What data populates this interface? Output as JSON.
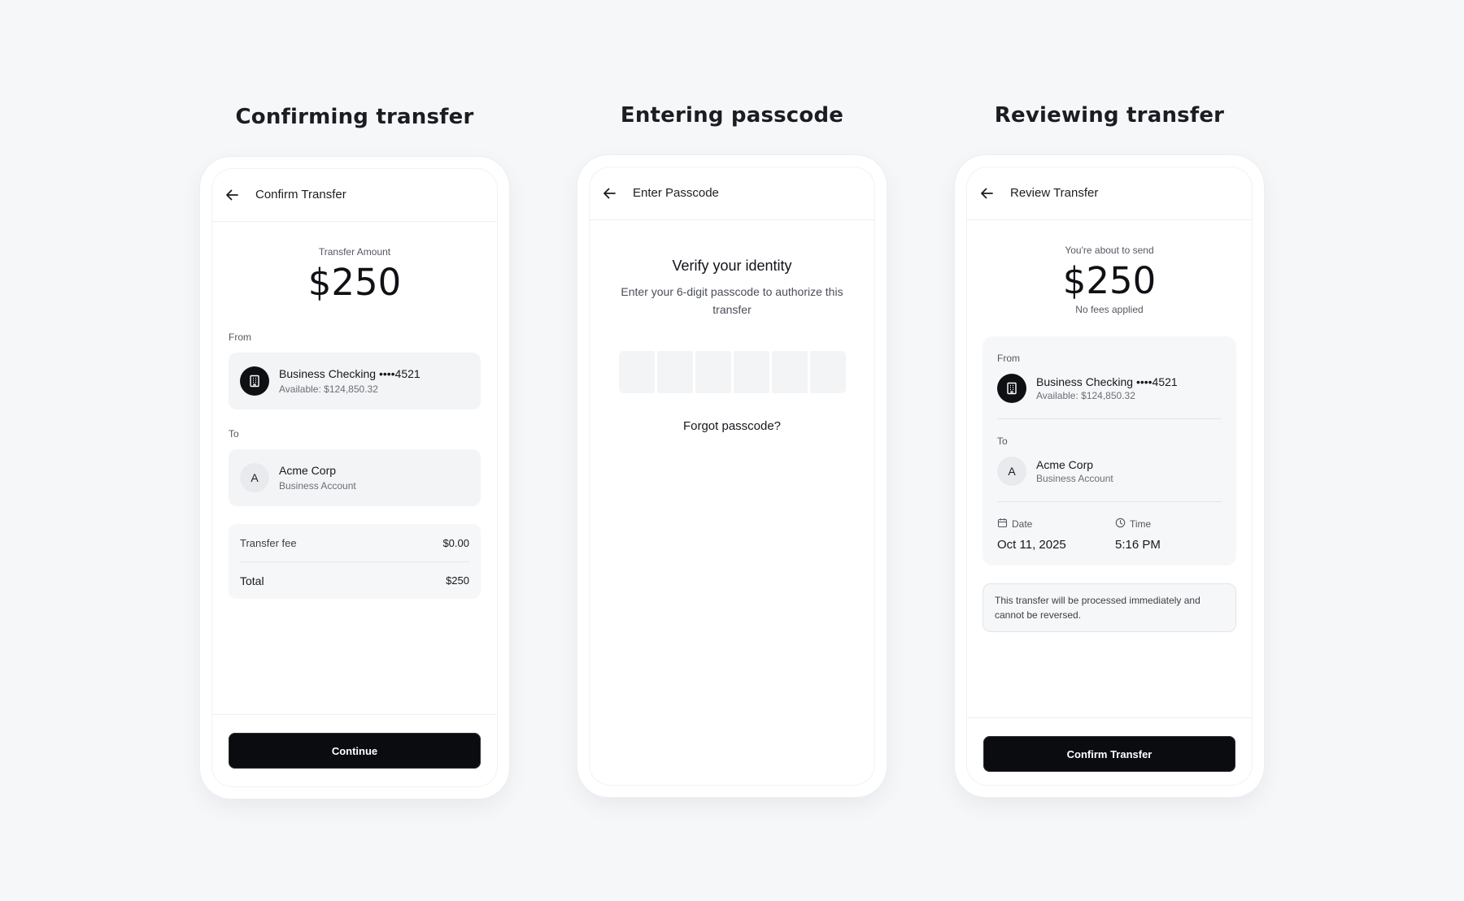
{
  "panels": {
    "confirm": {
      "heading": "Confirming transfer",
      "screen_title": "Confirm Transfer",
      "amount_label": "Transfer Amount",
      "amount": "$250",
      "from_label": "From",
      "from_account": {
        "name": "Business Checking ••••4521",
        "detail": "Available: $124,850.32",
        "icon": "building-icon"
      },
      "to_label": "To",
      "to_account": {
        "initial": "A",
        "name": "Acme Corp",
        "detail": "Business Account"
      },
      "fee_label": "Transfer fee",
      "fee_value": "$0.00",
      "total_label": "Total",
      "total_value": "$250",
      "button_label": "Continue"
    },
    "passcode": {
      "heading": "Entering passcode",
      "screen_title": "Enter Passcode",
      "title": "Verify your identity",
      "description": "Enter your 6-digit passcode to authorize this transfer",
      "digits": [
        "",
        "",
        "",
        "",
        "",
        ""
      ],
      "forgot_label": "Forgot passcode?"
    },
    "review": {
      "heading": "Reviewing transfer",
      "screen_title": "Review Transfer",
      "about_label": "You're about to send",
      "amount": "$250",
      "fees_note": "No fees applied",
      "from_label": "From",
      "from_account": {
        "name": "Business Checking ••••4521",
        "detail": "Available: $124,850.32",
        "icon": "building-icon"
      },
      "to_label": "To",
      "to_account": {
        "initial": "A",
        "name": "Acme Corp",
        "detail": "Business Account"
      },
      "date_label": "Date",
      "date_value": "Oct 11, 2025",
      "time_label": "Time",
      "time_value": "5:16 PM",
      "notice": "This transfer will be processed immediately and cannot be reversed.",
      "button_label": "Confirm Transfer"
    }
  },
  "colors": {
    "background": "#f6f7f9",
    "primary_button": "#0b0c10",
    "card": "#f3f4f6"
  }
}
